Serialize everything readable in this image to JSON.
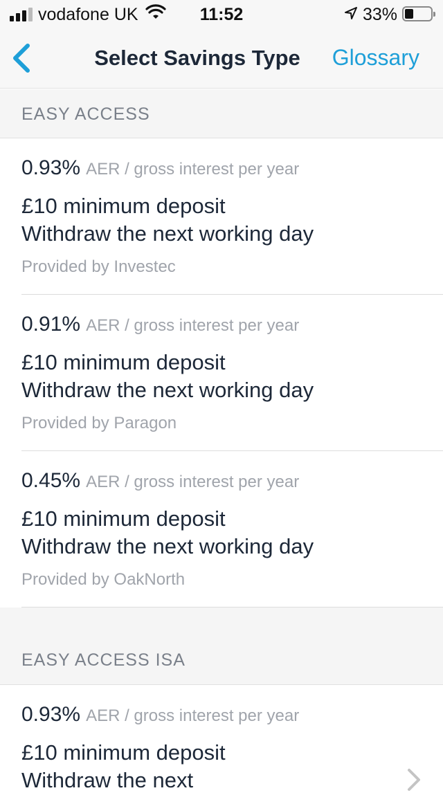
{
  "status_bar": {
    "carrier": "vodafone UK",
    "time": "11:52",
    "battery": "33%"
  },
  "nav": {
    "title": "Select Savings Type",
    "glossary_label": "Glossary"
  },
  "sections": [
    {
      "label": "EASY ACCESS",
      "products": [
        {
          "rate": "0.93%",
          "rate_desc": "AER / gross interest per year",
          "deposit": "£10 minimum deposit",
          "withdraw": "Withdraw the next working day",
          "provider": "Provided by Investec"
        },
        {
          "rate": "0.91%",
          "rate_desc": "AER / gross interest per year",
          "deposit": "£10 minimum deposit",
          "withdraw": "Withdraw the next working day",
          "provider": "Provided by Paragon"
        },
        {
          "rate": "0.45%",
          "rate_desc": "AER / gross interest per year",
          "deposit": "£10 minimum deposit",
          "withdraw": "Withdraw the next working day",
          "provider": "Provided by OakNorth"
        }
      ]
    },
    {
      "label": "EASY ACCESS ISA",
      "products": [
        {
          "rate": "0.93%",
          "rate_desc": "AER / gross interest per year",
          "deposit": "£10 minimum deposit",
          "withdraw": "Withdraw the next"
        }
      ]
    }
  ],
  "colors": {
    "accent": "#1e9fd8",
    "text": "#1d2838",
    "muted": "#a0a4ab",
    "header_bg": "#f5f5f5"
  }
}
